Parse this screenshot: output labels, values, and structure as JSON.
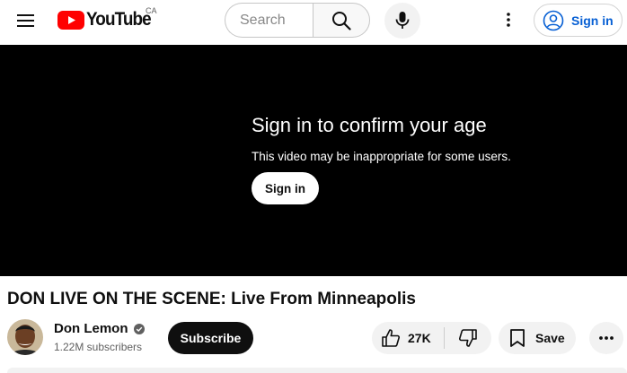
{
  "header": {
    "logo_text": "YouTube",
    "region": "CA",
    "search_placeholder": "Search",
    "signin_label": "Sign in"
  },
  "player": {
    "age_title": "Sign in to confirm your age",
    "age_subtitle": "This video may be inappropriate for some users.",
    "signin_label": "Sign in"
  },
  "video": {
    "title": "DON LIVE ON THE SCENE: Live From Minneapolis",
    "channel_name": "Don Lemon",
    "subscribers": "1.22M subscribers",
    "subscribe_label": "Subscribe",
    "like_count": "27K",
    "save_label": "Save"
  },
  "colors": {
    "brand_red": "#ff0000",
    "link_blue": "#065fd4",
    "player_bg": "#000000"
  },
  "icons": [
    "menu-icon",
    "youtube-logo-icon",
    "search-icon",
    "mic-icon",
    "more-vert-icon",
    "account-icon",
    "verified-icon",
    "thumbs-up-icon",
    "thumbs-down-icon",
    "save-icon",
    "more-horiz-icon"
  ]
}
